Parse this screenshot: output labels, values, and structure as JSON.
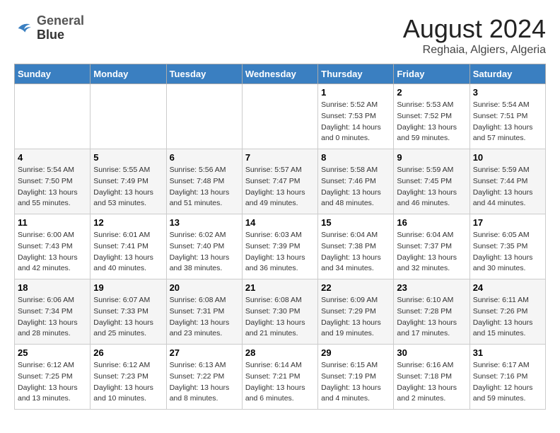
{
  "header": {
    "logo_line1": "General",
    "logo_line2": "Blue",
    "month_year": "August 2024",
    "location": "Reghaia, Algiers, Algeria"
  },
  "weekdays": [
    "Sunday",
    "Monday",
    "Tuesday",
    "Wednesday",
    "Thursday",
    "Friday",
    "Saturday"
  ],
  "weeks": [
    [
      null,
      null,
      null,
      null,
      {
        "day": "1",
        "sunrise": "5:52 AM",
        "sunset": "7:53 PM",
        "daylight": "14 hours and 0 minutes."
      },
      {
        "day": "2",
        "sunrise": "5:53 AM",
        "sunset": "7:52 PM",
        "daylight": "13 hours and 59 minutes."
      },
      {
        "day": "3",
        "sunrise": "5:54 AM",
        "sunset": "7:51 PM",
        "daylight": "13 hours and 57 minutes."
      }
    ],
    [
      {
        "day": "4",
        "sunrise": "5:54 AM",
        "sunset": "7:50 PM",
        "daylight": "13 hours and 55 minutes."
      },
      {
        "day": "5",
        "sunrise": "5:55 AM",
        "sunset": "7:49 PM",
        "daylight": "13 hours and 53 minutes."
      },
      {
        "day": "6",
        "sunrise": "5:56 AM",
        "sunset": "7:48 PM",
        "daylight": "13 hours and 51 minutes."
      },
      {
        "day": "7",
        "sunrise": "5:57 AM",
        "sunset": "7:47 PM",
        "daylight": "13 hours and 49 minutes."
      },
      {
        "day": "8",
        "sunrise": "5:58 AM",
        "sunset": "7:46 PM",
        "daylight": "13 hours and 48 minutes."
      },
      {
        "day": "9",
        "sunrise": "5:59 AM",
        "sunset": "7:45 PM",
        "daylight": "13 hours and 46 minutes."
      },
      {
        "day": "10",
        "sunrise": "5:59 AM",
        "sunset": "7:44 PM",
        "daylight": "13 hours and 44 minutes."
      }
    ],
    [
      {
        "day": "11",
        "sunrise": "6:00 AM",
        "sunset": "7:43 PM",
        "daylight": "13 hours and 42 minutes."
      },
      {
        "day": "12",
        "sunrise": "6:01 AM",
        "sunset": "7:41 PM",
        "daylight": "13 hours and 40 minutes."
      },
      {
        "day": "13",
        "sunrise": "6:02 AM",
        "sunset": "7:40 PM",
        "daylight": "13 hours and 38 minutes."
      },
      {
        "day": "14",
        "sunrise": "6:03 AM",
        "sunset": "7:39 PM",
        "daylight": "13 hours and 36 minutes."
      },
      {
        "day": "15",
        "sunrise": "6:04 AM",
        "sunset": "7:38 PM",
        "daylight": "13 hours and 34 minutes."
      },
      {
        "day": "16",
        "sunrise": "6:04 AM",
        "sunset": "7:37 PM",
        "daylight": "13 hours and 32 minutes."
      },
      {
        "day": "17",
        "sunrise": "6:05 AM",
        "sunset": "7:35 PM",
        "daylight": "13 hours and 30 minutes."
      }
    ],
    [
      {
        "day": "18",
        "sunrise": "6:06 AM",
        "sunset": "7:34 PM",
        "daylight": "13 hours and 28 minutes."
      },
      {
        "day": "19",
        "sunrise": "6:07 AM",
        "sunset": "7:33 PM",
        "daylight": "13 hours and 25 minutes."
      },
      {
        "day": "20",
        "sunrise": "6:08 AM",
        "sunset": "7:31 PM",
        "daylight": "13 hours and 23 minutes."
      },
      {
        "day": "21",
        "sunrise": "6:08 AM",
        "sunset": "7:30 PM",
        "daylight": "13 hours and 21 minutes."
      },
      {
        "day": "22",
        "sunrise": "6:09 AM",
        "sunset": "7:29 PM",
        "daylight": "13 hours and 19 minutes."
      },
      {
        "day": "23",
        "sunrise": "6:10 AM",
        "sunset": "7:28 PM",
        "daylight": "13 hours and 17 minutes."
      },
      {
        "day": "24",
        "sunrise": "6:11 AM",
        "sunset": "7:26 PM",
        "daylight": "13 hours and 15 minutes."
      }
    ],
    [
      {
        "day": "25",
        "sunrise": "6:12 AM",
        "sunset": "7:25 PM",
        "daylight": "13 hours and 13 minutes."
      },
      {
        "day": "26",
        "sunrise": "6:12 AM",
        "sunset": "7:23 PM",
        "daylight": "13 hours and 10 minutes."
      },
      {
        "day": "27",
        "sunrise": "6:13 AM",
        "sunset": "7:22 PM",
        "daylight": "13 hours and 8 minutes."
      },
      {
        "day": "28",
        "sunrise": "6:14 AM",
        "sunset": "7:21 PM",
        "daylight": "13 hours and 6 minutes."
      },
      {
        "day": "29",
        "sunrise": "6:15 AM",
        "sunset": "7:19 PM",
        "daylight": "13 hours and 4 minutes."
      },
      {
        "day": "30",
        "sunrise": "6:16 AM",
        "sunset": "7:18 PM",
        "daylight": "13 hours and 2 minutes."
      },
      {
        "day": "31",
        "sunrise": "6:17 AM",
        "sunset": "7:16 PM",
        "daylight": "12 hours and 59 minutes."
      }
    ]
  ]
}
